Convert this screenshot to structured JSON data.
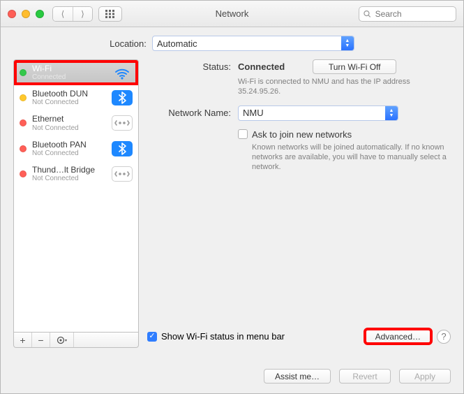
{
  "window": {
    "title": "Network",
    "search_placeholder": "Search"
  },
  "location": {
    "label": "Location:",
    "value": "Automatic"
  },
  "services": [
    {
      "name": "Wi-Fi",
      "sub": "Connected",
      "dot": "green",
      "icon": "wifi",
      "selected": true
    },
    {
      "name": "Bluetooth DUN",
      "sub": "Not Connected",
      "dot": "yellow",
      "icon": "bluetooth",
      "selected": false
    },
    {
      "name": "Ethernet",
      "sub": "Not Connected",
      "dot": "red",
      "icon": "ethernet",
      "selected": false
    },
    {
      "name": "Bluetooth PAN",
      "sub": "Not Connected",
      "dot": "red",
      "icon": "bluetooth",
      "selected": false
    },
    {
      "name": "Thund…lt Bridge",
      "sub": "Not Connected",
      "dot": "red",
      "icon": "ethernet",
      "selected": false
    }
  ],
  "detail": {
    "status_label": "Status:",
    "status_value": "Connected",
    "turn_off_label": "Turn Wi-Fi Off",
    "status_desc": "Wi-Fi is connected to NMU and has the IP address 35.24.95.26.",
    "network_name_label": "Network Name:",
    "network_name_value": "NMU",
    "ask_join_label": "Ask to join new networks",
    "ask_join_desc": "Known networks will be joined automatically. If no known networks are available, you will have to manually select a network.",
    "show_menu_label": "Show Wi-Fi status in menu bar",
    "advanced_label": "Advanced…"
  },
  "footer": {
    "assist": "Assist me…",
    "revert": "Revert",
    "apply": "Apply"
  }
}
